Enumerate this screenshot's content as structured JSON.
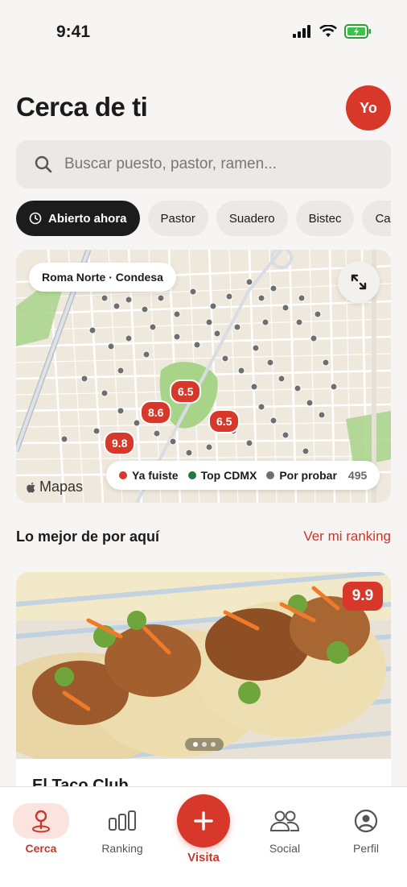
{
  "status_bar": {
    "time": "9:41"
  },
  "header": {
    "title": "Cerca de ti",
    "avatar_initials": "Yo"
  },
  "search": {
    "placeholder": "Buscar puesto, pastor, ramen..."
  },
  "filters": [
    {
      "label": "Abierto ahora",
      "active": true,
      "icon": "clock-icon"
    },
    {
      "label": "Pastor",
      "active": false
    },
    {
      "label": "Suadero",
      "active": false
    },
    {
      "label": "Bistec",
      "active": false
    },
    {
      "label": "Carnitas",
      "active": false
    }
  ],
  "map": {
    "area": "Roma Norte · Condesa",
    "brand": "Mapas",
    "pins": [
      "6.5",
      "8.6",
      "6.5",
      "9.8"
    ],
    "legend": [
      {
        "label": "Ya fuiste",
        "color": "#d7382a"
      },
      {
        "label": "Top CDMX",
        "color": "#1f7a3f"
      },
      {
        "label": "Por probar",
        "color": "#6f6f6f"
      }
    ],
    "count": "495"
  },
  "section": {
    "title": "Lo mejor de por aquí",
    "link": "Ver mi ranking"
  },
  "featured": {
    "name": "El Taco Club",
    "score": "9.9",
    "photo_count": 3
  },
  "tabbar": {
    "items": [
      {
        "label": "Cerca",
        "icon": "pin-icon",
        "active": true
      },
      {
        "label": "Ranking",
        "icon": "bars-icon",
        "active": false
      },
      {
        "label": "Visita",
        "icon": "plus-icon",
        "active": false
      },
      {
        "label": "Social",
        "icon": "people-icon",
        "active": false
      },
      {
        "label": "Perfil",
        "icon": "profile-icon",
        "active": false
      }
    ]
  },
  "colors": {
    "accent": "#d7382a",
    "dark_chip": "#1c1c1e",
    "background": "#f6f5f3"
  }
}
